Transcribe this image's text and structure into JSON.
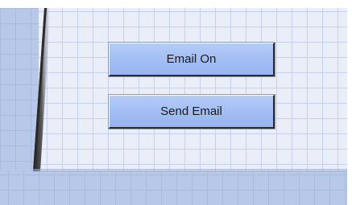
{
  "buttons": {
    "email_on_label": "Email On",
    "send_email_label": "Send Email"
  },
  "colors": {
    "grid_background": "#e9eef9",
    "grid_lines": "#c7d1ec",
    "panel_dark": "#b8c8e8",
    "button_fill": "#a2bdf3",
    "button_border_dark": "#2b2b2b"
  }
}
